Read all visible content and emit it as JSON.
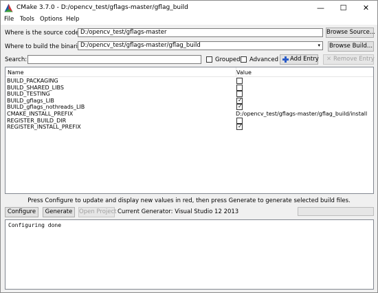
{
  "window": {
    "title": "CMake 3.7.0 - D:/opencv_test/gflags-master/gflag_build",
    "controls": {
      "minimize": "—",
      "maximize": "☐",
      "close": "✕"
    }
  },
  "menu": [
    "File",
    "Tools",
    "Options",
    "Help"
  ],
  "source": {
    "label": "Where is the source code:",
    "value": "D:/opencv_test/gflags-master",
    "browse": "Browse Source..."
  },
  "build": {
    "label": "Where to build the binaries:",
    "value": "D:/opencv_test/gflags-master/gflag_build",
    "browse": "Browse Build..."
  },
  "search": {
    "label": "Search:",
    "value": "",
    "grouped": "Grouped",
    "advanced": "Advanced",
    "add_entry": "Add Entry",
    "remove_entry": "Remove Entry"
  },
  "table": {
    "headers": [
      "Name",
      "Value"
    ],
    "rows": [
      {
        "name": "BUILD_PACKAGING",
        "type": "bool",
        "checked": false
      },
      {
        "name": "BUILD_SHARED_LIBS",
        "type": "bool",
        "checked": false
      },
      {
        "name": "BUILD_TESTING",
        "type": "bool",
        "checked": false
      },
      {
        "name": "BUILD_gflags_LIB",
        "type": "bool",
        "checked": true
      },
      {
        "name": "BUILD_gflags_nothreads_LIB",
        "type": "bool",
        "checked": true
      },
      {
        "name": "CMAKE_INSTALL_PREFIX",
        "type": "text",
        "value": "D:/opencv_test/gflags-master/gflag_build/install"
      },
      {
        "name": "REGISTER_BUILD_DIR",
        "type": "bool",
        "checked": false
      },
      {
        "name": "REGISTER_INSTALL_PREFIX",
        "type": "bool",
        "checked": true
      }
    ]
  },
  "status_text": "Press Configure to update and display new values in red, then press Generate to generate selected build files.",
  "actions": {
    "configure": "Configure",
    "generate": "Generate",
    "open_project": "Open Project",
    "generator": "Current Generator: Visual Studio 12 2013"
  },
  "output": "Configuring done"
}
